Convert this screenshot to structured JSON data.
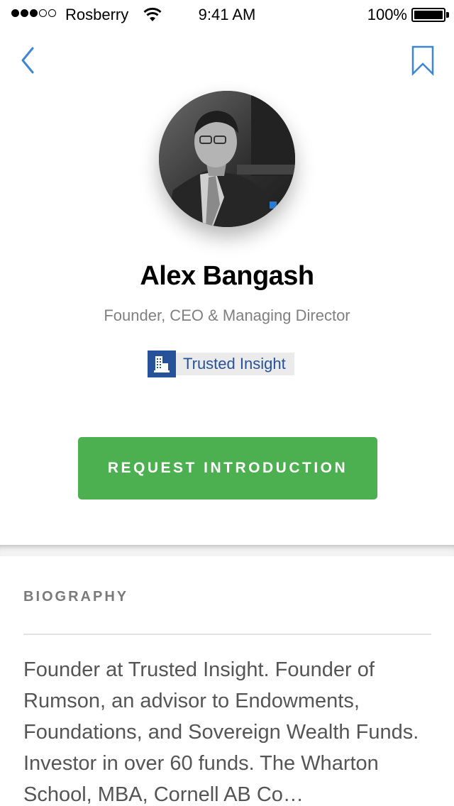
{
  "status_bar": {
    "carrier": "Rosberry",
    "time": "9:41 AM",
    "battery": "100%"
  },
  "nav": {
    "back_icon": "chevron-left-icon",
    "bookmark_icon": "bookmark-icon",
    "accent_color": "#3d86d6"
  },
  "profile": {
    "name": "Alex Bangash",
    "title": "Founder, CEO & Managing Director",
    "company": {
      "name": "Trusted Insight",
      "icon": "building-icon",
      "color": "#27529a"
    }
  },
  "actions": {
    "request_label": "REQUEST INTRODUCTION",
    "button_color": "#4caf50"
  },
  "biography": {
    "heading": "BIOGRAPHY",
    "text": "Founder at Trusted Insight. Founder of Rumson, an advisor to Endowments, Foundations, and Sovereign Wealth Funds. Investor in over 60 funds. The Wharton School, MBA, Cornell AB Co…"
  }
}
